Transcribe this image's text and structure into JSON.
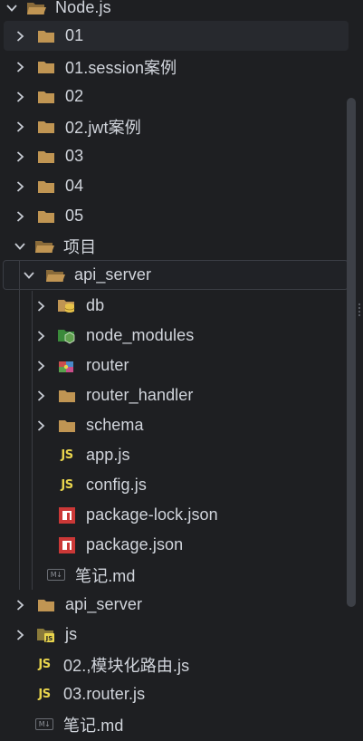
{
  "tree": {
    "root": {
      "label": "Node.js"
    },
    "items": [
      {
        "label": "01"
      },
      {
        "label": "01.session案例"
      },
      {
        "label": "02"
      },
      {
        "label": "02.jwt案例"
      },
      {
        "label": "03"
      },
      {
        "label": "04"
      },
      {
        "label": "05"
      },
      {
        "label": "项目"
      },
      {
        "label": "api_server"
      },
      {
        "label": "db"
      },
      {
        "label": "node_modules"
      },
      {
        "label": "router"
      },
      {
        "label": "router_handler"
      },
      {
        "label": "schema"
      },
      {
        "label": "app.js"
      },
      {
        "label": "config.js"
      },
      {
        "label": "package-lock.json"
      },
      {
        "label": "package.json"
      },
      {
        "label": "笔记.md"
      },
      {
        "label": "api_server"
      },
      {
        "label": "js"
      },
      {
        "label": "02.,模块化路由.js"
      },
      {
        "label": "03.router.js"
      },
      {
        "label": "笔记.md"
      }
    ]
  },
  "icons": {
    "folder": "folder-icon",
    "folder_open": "folder-open-icon",
    "database_folder": "database-folder-icon",
    "node_folder": "node-modules-folder-icon",
    "router_folder": "router-folder-icon",
    "js_file": "js-file-icon",
    "npm_file": "npm-file-icon",
    "markdown_file": "markdown-file-icon",
    "js_folder": "js-folder-icon"
  },
  "colors": {
    "background": "#1e1f22",
    "folder": "#c09553",
    "js": "#e8d44d",
    "npm": "#cb3837",
    "text": "#d1d5dc"
  },
  "glyphs": {
    "js": "JS",
    "md": "M↓"
  }
}
